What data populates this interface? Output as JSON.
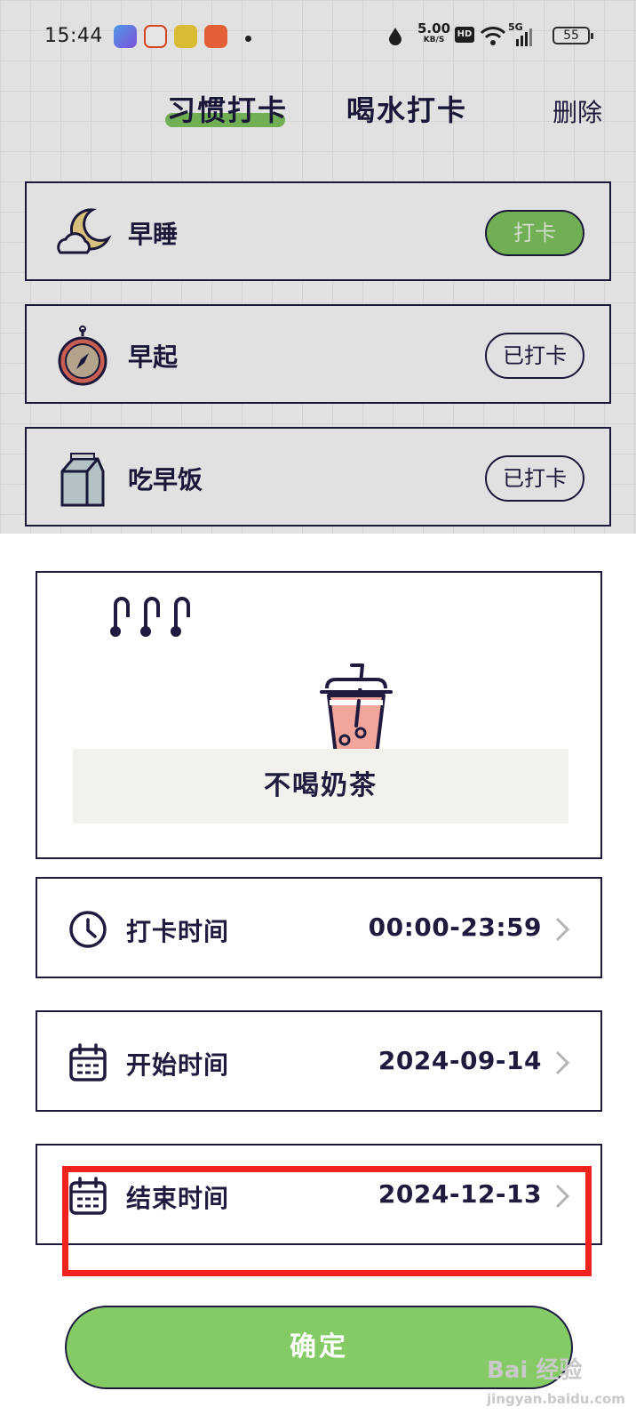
{
  "status_bar": {
    "time": "15:44",
    "net_speed_value": "5.00",
    "net_speed_unit": "KB/S",
    "hd_label": "HD",
    "network_label": "5G",
    "battery": "55"
  },
  "header": {
    "tabs": [
      {
        "label": "习惯打卡",
        "active": true
      },
      {
        "label": "喝水打卡",
        "active": false
      }
    ],
    "delete_label": "删除"
  },
  "habit_list": [
    {
      "label": "早睡",
      "icon": "moon-cloud-icon",
      "button": "打卡"
    },
    {
      "label": "早起",
      "icon": "compass-icon",
      "button": "已打卡"
    },
    {
      "label": "吃早饭",
      "icon": "milk-carton-icon",
      "button": "已打卡"
    }
  ],
  "sheet": {
    "habit_name": "不喝奶茶",
    "habit_icon": "bubble-tea-icon",
    "settings": [
      {
        "label": "打卡时间",
        "value": "00:00-23:59",
        "icon": "clock-icon"
      },
      {
        "label": "开始时间",
        "value": "2024-09-14",
        "icon": "calendar-icon"
      },
      {
        "label": "结束时间",
        "value": "2024-12-13",
        "icon": "calendar-icon"
      }
    ],
    "confirm_label": "确定"
  },
  "watermark": {
    "main": "Bai 经验",
    "sub": "jingyan.baidu.com"
  },
  "colors": {
    "ink": "#1e1b3f",
    "accent_green": "#84cb66",
    "highlight_red": "#f2231f",
    "name_box_bg": "#f3f1ec",
    "cup_fill": "#f2a59a"
  }
}
